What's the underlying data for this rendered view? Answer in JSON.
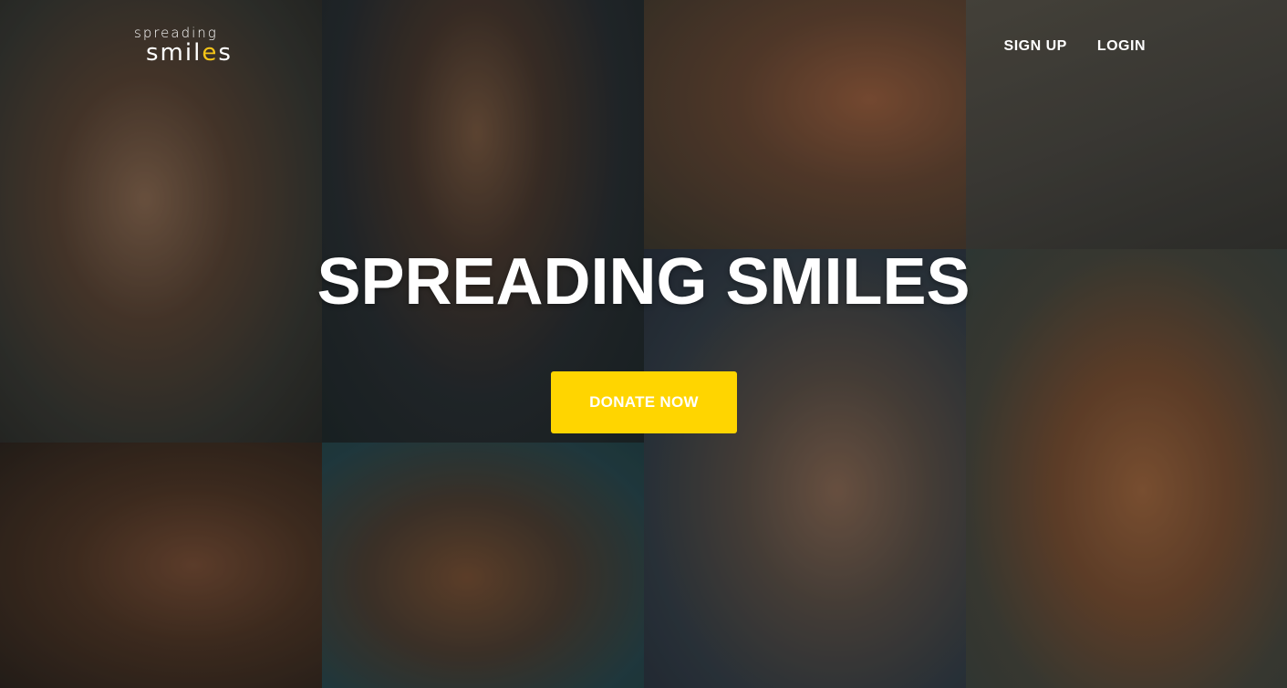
{
  "header": {
    "logo": {
      "top_text": "spreading",
      "bottom_text_pre": "smil",
      "bottom_text_swoosh": "e",
      "bottom_text_post": "s"
    },
    "nav": {
      "signup_label": "SIGN UP",
      "login_label": "LOGIN"
    }
  },
  "hero": {
    "title": "SPREADING SMILES",
    "donate_label": "DONATE NOW",
    "background_tiles": [
      "smiling-child-photo",
      "smiling-boy-photo",
      "two-children-photo",
      "children-writing-photo",
      "schoolchildren-photo",
      "laughing-girl-photo",
      "group-of-children-photo",
      "two-girls-photo"
    ]
  },
  "colors": {
    "accent": "#ffd500",
    "text": "#ffffff"
  }
}
